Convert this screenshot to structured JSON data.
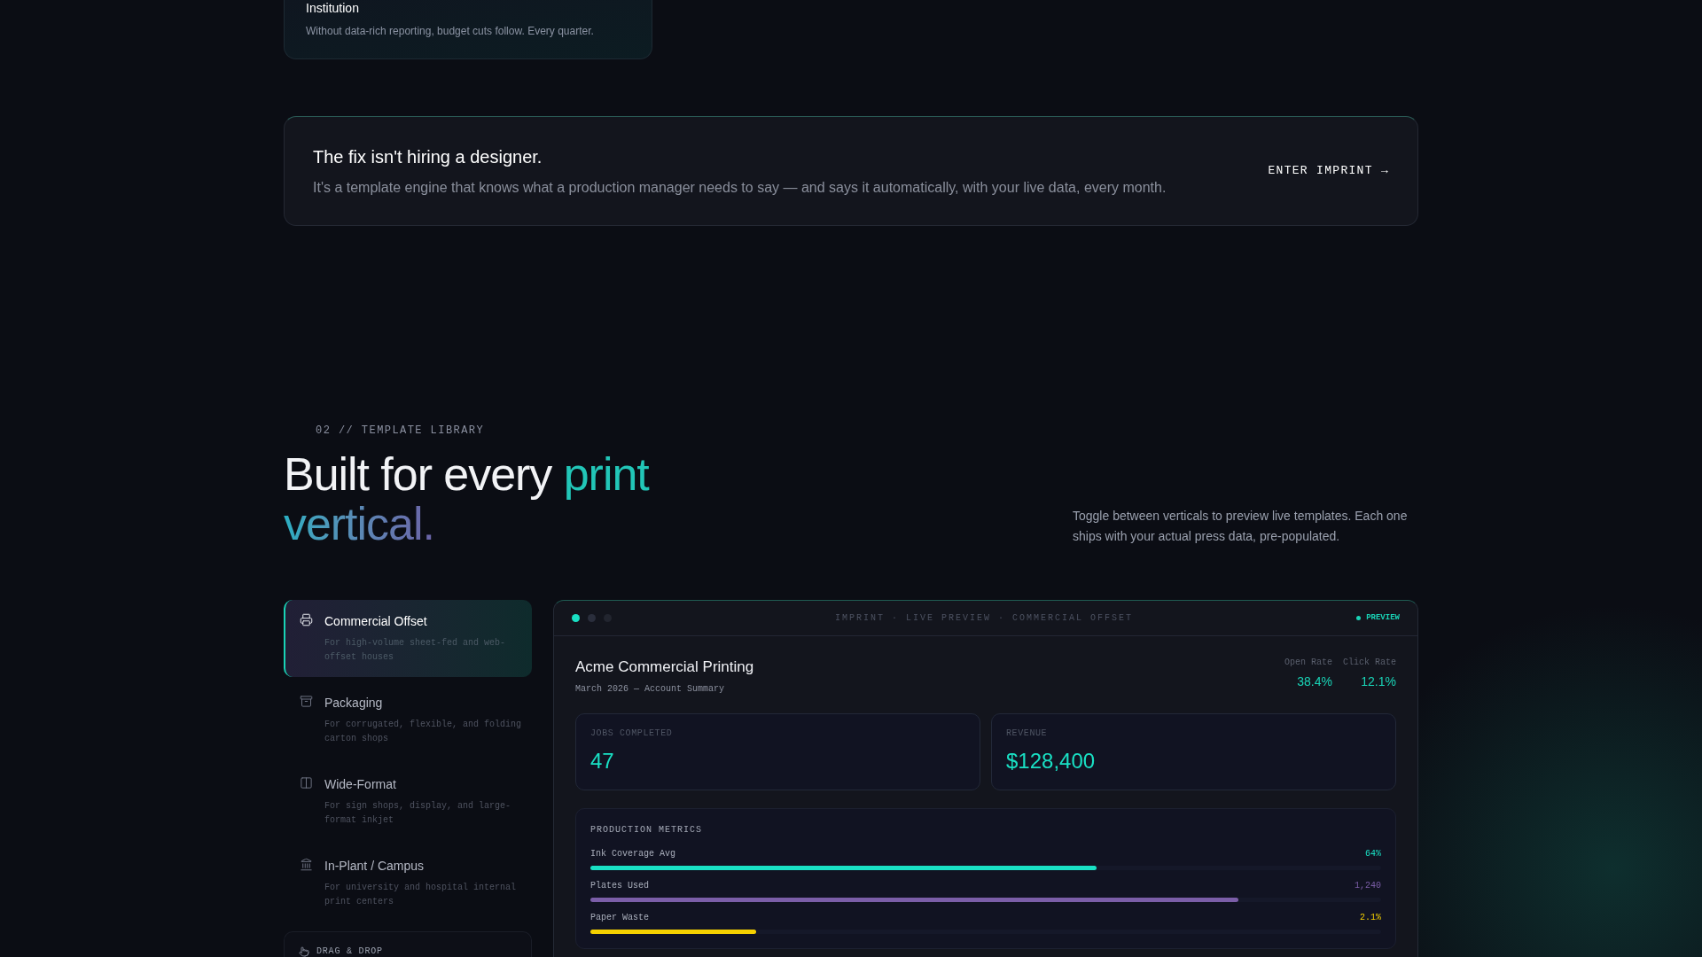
{
  "problem_card": {
    "title": "Institution",
    "description": "Without data-rich reporting, budget cuts follow. Every quarter."
  },
  "fix_banner": {
    "title": "The fix isn't hiring a designer.",
    "description": "It's a template engine that knows what a production manager needs to say — and says it automatically, with your live data, every month.",
    "button": "ENTER IMPRINT →"
  },
  "section": {
    "eyebrow": "02 // TEMPLATE LIBRARY",
    "heading": "Built for every",
    "heading_accent": "print",
    "heading_accent_2": "vertical.",
    "intro": "Toggle between verticals to preview live templates. Each one ships with your actual press data, pre-populated."
  },
  "verticals": [
    {
      "title": "Commercial Offset",
      "description": "For high-volume sheet-fed and web-offset houses",
      "selected": true
    },
    {
      "title": "Packaging",
      "description": "For corrugated, flexible, and folding carton shops",
      "selected": false
    },
    {
      "title": "Wide-Format",
      "description": "For sign shops, display, and large-format inkjet",
      "selected": false
    },
    {
      "title": "In-Plant / Campus",
      "description": "For university and hospital internal print centers",
      "selected": false
    }
  ],
  "drag_drop": {
    "label": "DRAG & DROP"
  },
  "preview": {
    "bar_title": "IMPRINT · LIVE PREVIEW · COMMERCIAL OFFSET",
    "badge": "PREVIEW",
    "company": "Acme Commercial Printing",
    "subtitle": "March 2026 — Account Summary",
    "rates": [
      {
        "label": "Open Rate",
        "value": "38.4%"
      },
      {
        "label": "Click Rate",
        "value": "12.1%"
      }
    ],
    "stats": [
      {
        "label": "JOBS COMPLETED",
        "value": "47"
      },
      {
        "label": "REVENUE",
        "value": "$128,400"
      }
    ],
    "metrics_title": "PRODUCTION METRICS",
    "metrics": [
      {
        "name": "Ink Coverage Avg",
        "reading": "64%",
        "level": 0.64,
        "color": "#19e0c4"
      },
      {
        "name": "Plates Used",
        "reading": "1,240",
        "level": 0.82,
        "color": "#7b5ea8"
      },
      {
        "name": "Paper Waste",
        "reading": "2.1%",
        "level": 0.21,
        "color": "#f5d000"
      }
    ]
  }
}
